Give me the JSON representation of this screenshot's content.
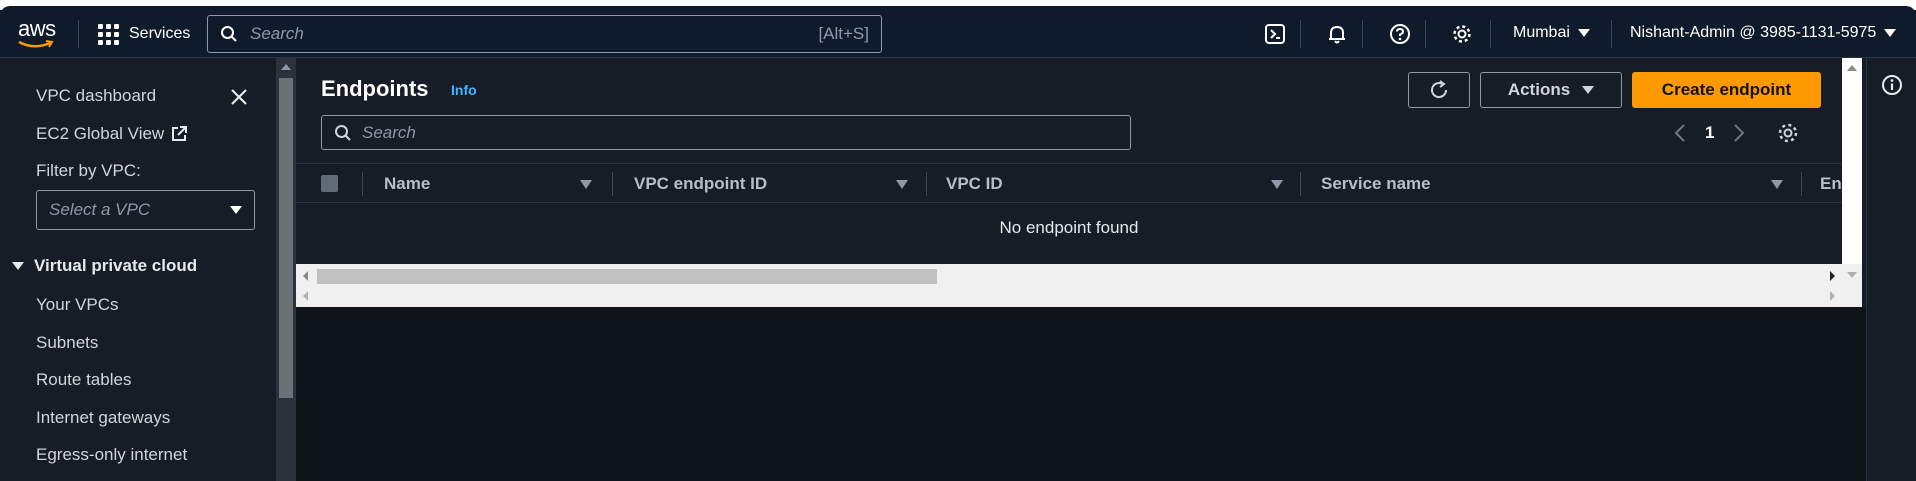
{
  "nav": {
    "logo_text": "aws",
    "services_label": "Services",
    "search_placeholder": "Search",
    "search_shortcut": "[Alt+S]",
    "region": "Mumbai",
    "account": "Nishant-Admin @ 3985-1131-5975"
  },
  "sidebar": {
    "dashboard": "VPC dashboard",
    "global_view": "EC2 Global View",
    "filter_label": "Filter by VPC:",
    "vpc_select_placeholder": "Select a VPC",
    "section_title": "Virtual private cloud",
    "items": [
      {
        "label": "Your VPCs"
      },
      {
        "label": "Subnets"
      },
      {
        "label": "Route tables"
      },
      {
        "label": "Internet gateways"
      },
      {
        "label": "Egress-only internet"
      }
    ]
  },
  "main": {
    "title": "Endpoints",
    "info_link": "Info",
    "actions_label": "Actions",
    "create_label": "Create endpoint",
    "search_placeholder": "Search",
    "page_number": "1",
    "columns": [
      {
        "label": "Name"
      },
      {
        "label": "VPC endpoint ID"
      },
      {
        "label": "VPC ID"
      },
      {
        "label": "Service name"
      },
      {
        "label": "En"
      }
    ],
    "empty_message": "No endpoint found"
  },
  "colors": {
    "primary_button": "#ff9900",
    "info_link": "#42b4ff",
    "background": "#161d26"
  }
}
